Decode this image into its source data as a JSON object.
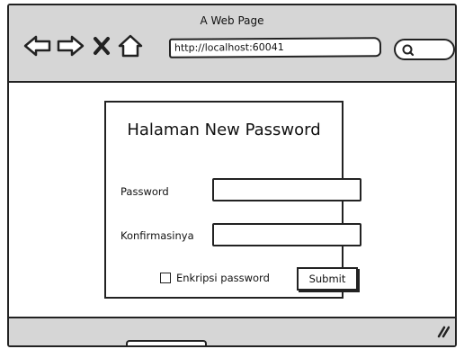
{
  "window": {
    "title": "A Web Page",
    "address": "http://localhost:60041"
  },
  "icons": {
    "back": "arrow-left-icon",
    "forward": "arrow-right-icon",
    "close": "close-x-icon",
    "home": "home-icon",
    "search": "search-icon",
    "resize": "resize-grip-icon"
  },
  "form": {
    "title": "Halaman New Password",
    "password_label": "Password",
    "password_value": "",
    "confirm_label": "Konfirmasinya",
    "confirm_value": "",
    "encrypt_label": "Enkripsi password",
    "encrypt_checked": false,
    "submit_label": "Submit"
  }
}
